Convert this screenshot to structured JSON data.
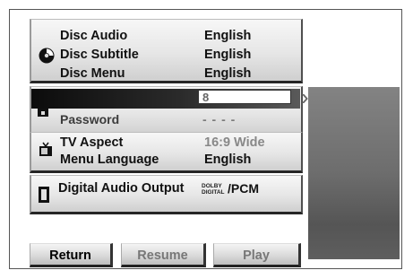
{
  "disc_panel": {
    "rows": [
      {
        "label": "Disc Audio",
        "value": "English"
      },
      {
        "label": "Disc Subtitle",
        "value": "English"
      },
      {
        "label": "Disc Menu",
        "value": "English"
      }
    ]
  },
  "lock_panel": {
    "entry_value": "8",
    "password_label": "Password",
    "password_value": "- - - -"
  },
  "display_panel": {
    "tv_aspect_label": "TV Aspect",
    "tv_aspect_value": "16:9 Wide",
    "menu_language_label": "Menu Language",
    "menu_language_value": "English"
  },
  "audio_panel": {
    "label": "Digital Audio Output",
    "dolby_line1": "DOLBY",
    "dolby_line2": "DIGITAL",
    "pcm": "/PCM"
  },
  "buttons": {
    "return": "Return",
    "resume": "Resume",
    "play": "Play"
  },
  "arrow": "›",
  "icons": {
    "disc": "disc-icon",
    "lock": "lock-icon",
    "tv": "tv-icon",
    "speaker": "speaker-icon"
  }
}
